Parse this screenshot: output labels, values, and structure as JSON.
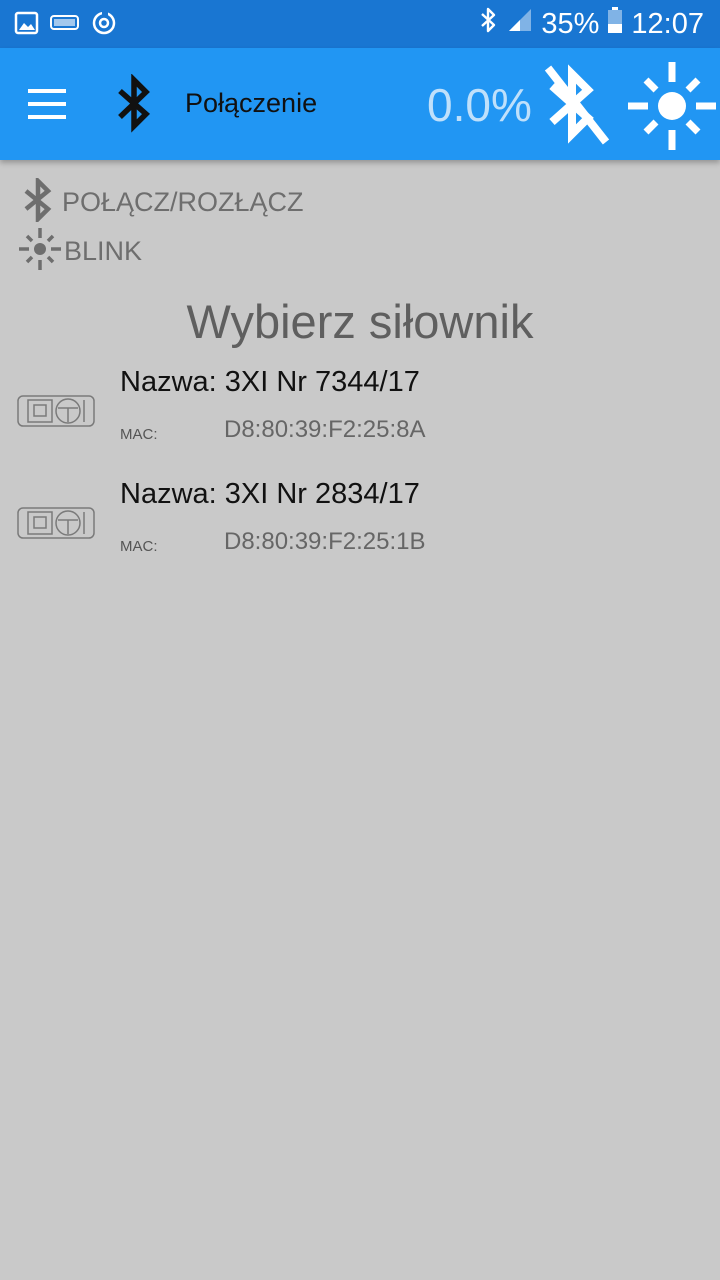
{
  "status_bar": {
    "battery": "35%",
    "time": "12:07",
    "notification_icons": [
      "gallery-icon",
      "zdub-badge-icon",
      "sync-icon"
    ],
    "system_icons": [
      "bluetooth-icon",
      "signal-icon",
      "battery-icon"
    ]
  },
  "app_bar": {
    "title": "Połączenie",
    "level": "0.0%",
    "menu_icon": "hamburger-menu-icon",
    "title_icon": "bluetooth-icon",
    "actions": [
      "bluetooth-disabled-icon",
      "sun-icon"
    ],
    "colors": {
      "primary": "#2196f3",
      "primary_dark": "#1976d2",
      "level_text": "#bfe0fb"
    }
  },
  "actions": {
    "connect": "POŁĄCZ/ROZŁĄCZ",
    "blink": "BLINK"
  },
  "section": {
    "title": "Wybierz siłownik"
  },
  "devices": [
    {
      "name": "Nazwa: 3XI Nr 7344/17",
      "mac_label": "MAC:",
      "mac": "D8:80:39:F2:25:8A"
    },
    {
      "name": "Nazwa: 3XI Nr 2834/17",
      "mac_label": "MAC:",
      "mac": "D8:80:39:F2:25:1B"
    }
  ],
  "background_color": "#c9c9c9"
}
